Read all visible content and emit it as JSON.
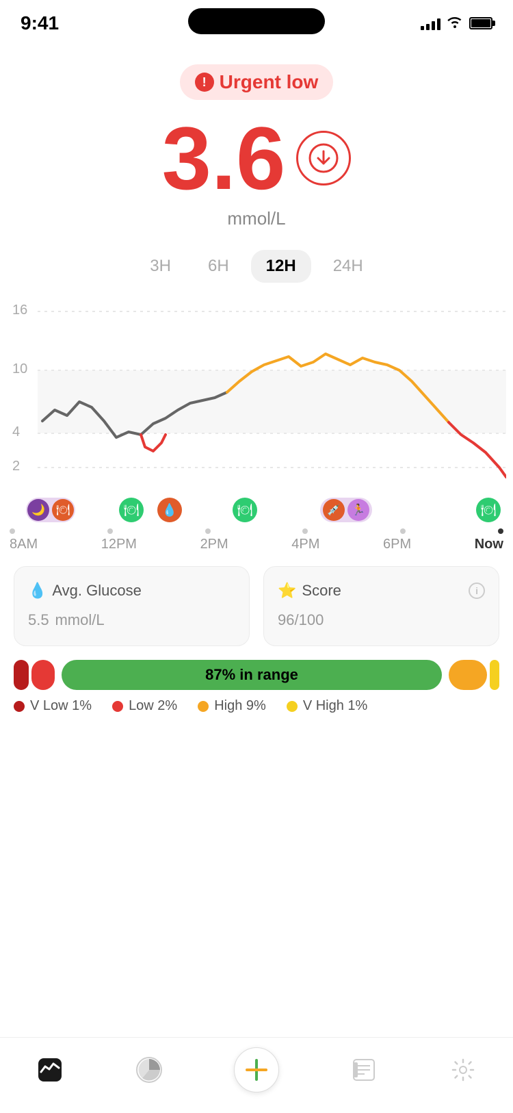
{
  "statusBar": {
    "time": "9:41",
    "battery": 100
  },
  "urgentBadge": {
    "label": "Urgent low"
  },
  "glucoseReading": {
    "value": "3.6",
    "unit": "mmol/L",
    "trend": "down"
  },
  "timeRange": {
    "options": [
      "3H",
      "6H",
      "12H",
      "24H"
    ],
    "active": "12H"
  },
  "chart": {
    "yLabels": [
      "16",
      "10",
      "4",
      "2"
    ],
    "xLabels": [
      "8AM",
      "12PM",
      "2PM",
      "4PM",
      "6PM",
      "Now"
    ]
  },
  "stats": {
    "avgGlucose": {
      "label": "Avg. Glucose",
      "value": "5.5",
      "unit": "mmol/L"
    },
    "score": {
      "label": "Score",
      "value": "96",
      "total": "/100"
    }
  },
  "inRange": {
    "percentage": "87%",
    "label": "in range",
    "legend": [
      {
        "label": "V Low",
        "value": "1%",
        "color": "#b71c1c"
      },
      {
        "label": "Low",
        "value": "2%",
        "color": "#e53935"
      },
      {
        "label": "High",
        "value": "9%",
        "color": "#f5a623"
      },
      {
        "label": "V High",
        "value": "1%",
        "color": "#f5d020"
      }
    ]
  },
  "nav": {
    "items": [
      "activity",
      "reports",
      "add",
      "logbook",
      "settings"
    ]
  }
}
